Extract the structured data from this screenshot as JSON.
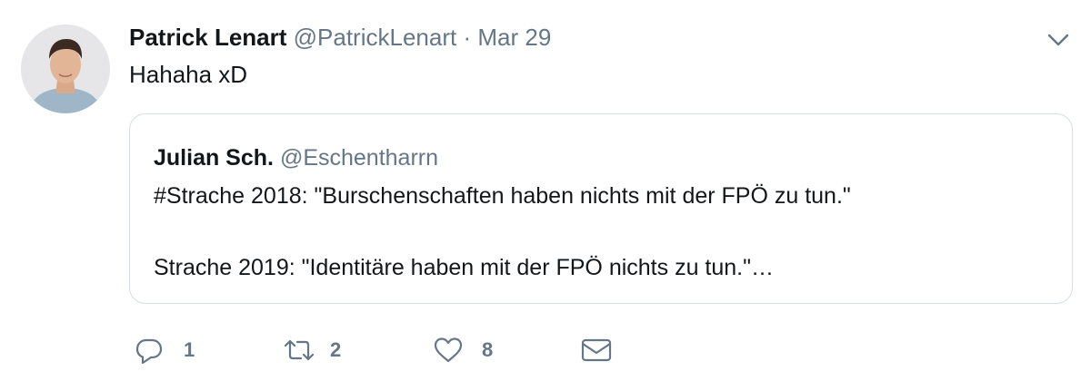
{
  "tweet": {
    "author_name": "Patrick Lenart",
    "author_handle": "@PatrickLenart",
    "separator": "·",
    "date": "Mar 29",
    "text": "Hahaha xD",
    "avatar_icon": "user-avatar-photo",
    "menu_icon": "chevron-down-icon"
  },
  "quoted_tweet": {
    "author_name": "Julian Sch.",
    "author_handle": "@Eschentharrn",
    "lines": [
      "#Strache 2018: \"Burschenschaften haben nichts mit der FPÖ zu tun.\"",
      "Strache 2019: \"Identitäre haben mit der FPÖ nichts zu tun.\"…"
    ]
  },
  "actions": {
    "reply": {
      "icon": "reply-icon",
      "count": "1"
    },
    "retweet": {
      "icon": "retweet-icon",
      "count": "2"
    },
    "like": {
      "icon": "heart-icon",
      "count": "8"
    },
    "direct_message": {
      "icon": "envelope-icon"
    }
  },
  "colors": {
    "text_primary": "#14171a",
    "text_secondary": "#657786",
    "border": "#d8dee3"
  }
}
